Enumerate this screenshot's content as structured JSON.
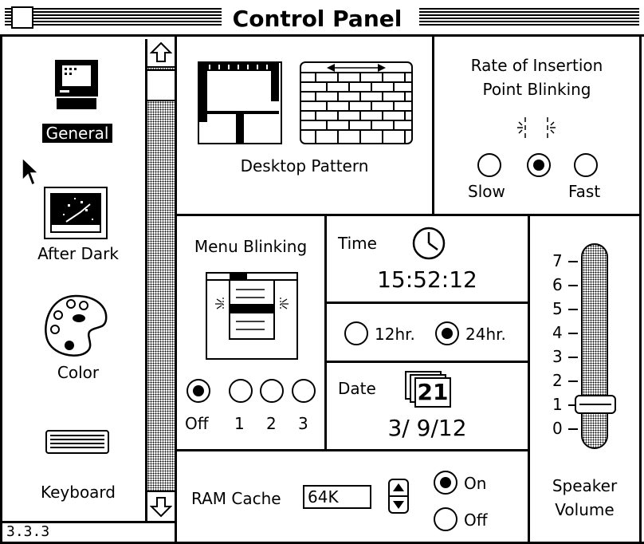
{
  "window": {
    "title": "Control Panel"
  },
  "sidebar": {
    "items": [
      {
        "label": "General",
        "selected": true,
        "icon": "macintosh-icon"
      },
      {
        "label": "After Dark",
        "selected": false,
        "icon": "after-dark-icon"
      },
      {
        "label": "Color",
        "selected": false,
        "icon": "palette-icon"
      },
      {
        "label": "Keyboard",
        "selected": false,
        "icon": "keyboard-icon"
      }
    ],
    "version": "3.3.3"
  },
  "desktop_pattern": {
    "label": "Desktop Pattern"
  },
  "blink_rate": {
    "title_line1": "Rate of Insertion",
    "title_line2": "Point Blinking",
    "slow_label": "Slow",
    "fast_label": "Fast",
    "selected_index": 1
  },
  "menu_blinking": {
    "title": "Menu Blinking",
    "options": [
      "Off",
      "1",
      "2",
      "3"
    ],
    "selected_index": 0
  },
  "time": {
    "label": "Time",
    "value": "15:52:12"
  },
  "clock_format": {
    "option_12": "12hr.",
    "option_24": "24hr.",
    "selected": "24hr."
  },
  "date": {
    "label": "Date",
    "value": "3/ 9/12",
    "icon_text": "21"
  },
  "ram_cache": {
    "label": "RAM Cache",
    "value": "64K",
    "on_label": "On",
    "off_label": "Off",
    "state": "On"
  },
  "speaker": {
    "label_line1": "Speaker",
    "label_line2": "Volume",
    "ticks": [
      "7",
      "6",
      "5",
      "4",
      "3",
      "2",
      "1",
      "0"
    ],
    "level": 1
  },
  "colors": {
    "foreground": "#000000",
    "background": "#ffffff"
  }
}
